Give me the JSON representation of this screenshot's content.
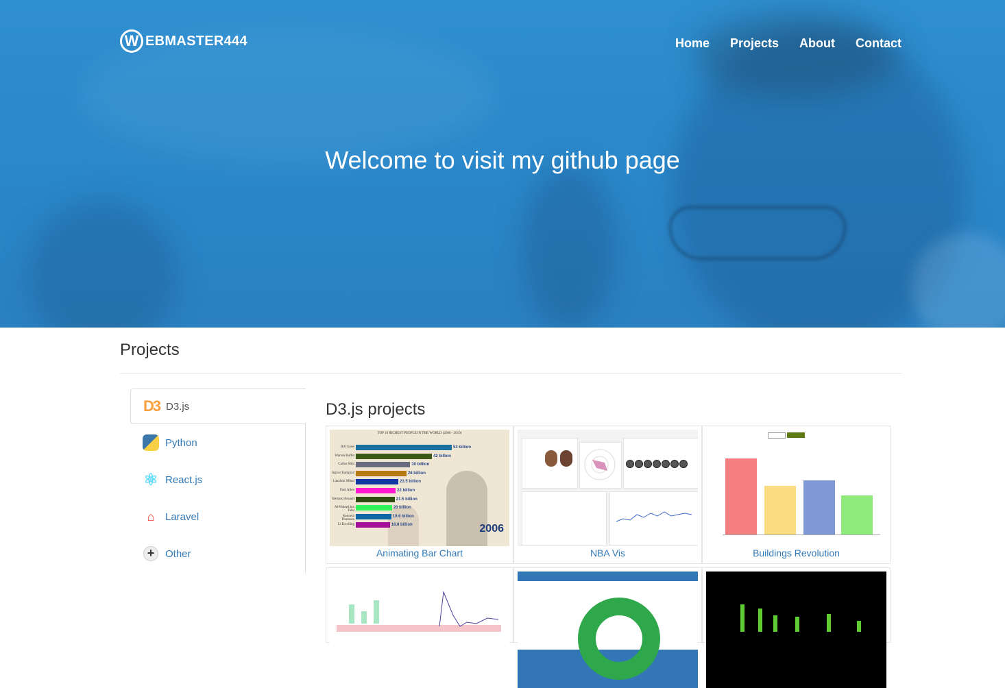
{
  "logo": {
    "letter": "W",
    "text": "EBMASTER444"
  },
  "nav": {
    "items": [
      "Home",
      "Projects",
      "About",
      "Contact"
    ]
  },
  "hero": {
    "title": "Welcome to visit my github page"
  },
  "projects": {
    "title": "Projects",
    "tabs": [
      {
        "label": "D3.js",
        "icon": "d3-icon",
        "active": true
      },
      {
        "label": "Python",
        "icon": "python-icon"
      },
      {
        "label": "React.js",
        "icon": "react-icon"
      },
      {
        "label": "Laravel",
        "icon": "laravel-icon"
      },
      {
        "label": "Other",
        "icon": "plus-icon"
      }
    ],
    "content_title": "D3.js projects",
    "cards": [
      {
        "caption": "Animating Bar Chart"
      },
      {
        "caption": "NBA Vis"
      },
      {
        "caption": "Buildings Revolution"
      }
    ]
  },
  "thumb_bar_chart": {
    "header": "TOP 10 RICHEST PEOPLE IN THE WORLD (2000 - 2019)",
    "year": "2006",
    "rows": [
      {
        "name": "Bill Gates",
        "value": "53 billion",
        "color": "#1b6f9e",
        "amount": 53
      },
      {
        "name": "Warren Buffet",
        "value": "42 billion",
        "color": "#3c5a16",
        "amount": 42
      },
      {
        "name": "Carlos Slim",
        "value": "30 billion",
        "color": "#6b6b80",
        "amount": 30
      },
      {
        "name": "Ingvar Kamprad",
        "value": "28 billion",
        "color": "#b7790c",
        "amount": 28
      },
      {
        "name": "Lakshmi Mittal",
        "value": "23.5 billion",
        "color": "#1136a6",
        "amount": 23.5
      },
      {
        "name": "Paul Allen",
        "value": "22 billion",
        "color": "#ff18d2",
        "amount": 22
      },
      {
        "name": "Bernard Arnault",
        "value": "21.5 billion",
        "color": "#2f4d10",
        "amount": 21.5
      },
      {
        "name": "Al-Waleed bin Talal",
        "value": "20 billion",
        "color": "#36f25a",
        "amount": 20
      },
      {
        "name": "Kenneth Thomson",
        "value": "19.6 billion",
        "color": "#0f64a6",
        "amount": 19.6
      },
      {
        "name": "Li Ka-shing",
        "value": "18.8 billion",
        "color": "#a5109a",
        "amount": 18.8
      }
    ]
  },
  "thumb_buildings": {
    "colors": [
      "#f57e80",
      "#f9dd80",
      "#7f9ad6",
      "#8fea7c"
    ]
  }
}
